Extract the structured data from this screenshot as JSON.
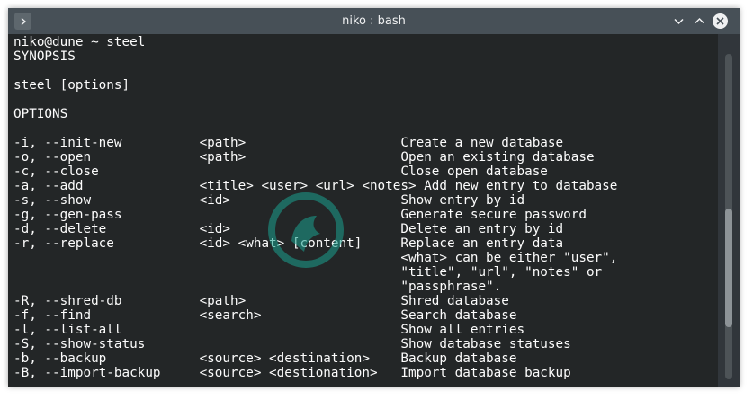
{
  "window": {
    "title": "niko : bash"
  },
  "terminal": {
    "lines": [
      "niko@dune ~ steel",
      "SYNOPSIS",
      "",
      "steel [options]",
      "",
      "OPTIONS",
      "",
      "-i, --init-new          <path>                    Create a new database",
      "-o, --open              <path>                    Open an existing database",
      "-c, --close                                       Close open database",
      "-a, --add               <title> <user> <url> <notes> Add new entry to database",
      "-s, --show              <id>                      Show entry by id",
      "-g, --gen-pass                                    Generate secure password",
      "-d, --delete            <id>                      Delete an entry by id",
      "-r, --replace           <id> <what> [content]     Replace an entry data",
      "                                                  <what> can be either \"user\",",
      "                                                  \"title\", \"url\", \"notes\" or",
      "                                                  \"passphrase\".",
      "-R, --shred-db          <path>                    Shred database",
      "-f, --find              <search>                  Search database",
      "-l, --list-all                                    Show all entries",
      "-S, --show-status                                 Show database statuses",
      "-b, --backup            <source> <destination>    Backup database",
      "-B, --import-backup     <source> <destionation>   Import database backup"
    ]
  },
  "icons": {
    "menu": "chevron-right-icon",
    "minimize": "chevron-down-icon",
    "maximize": "chevron-up-icon",
    "close": "close-icon"
  },
  "colors": {
    "titlebar": "#475057",
    "terminal_bg": "#232627",
    "terminal_fg": "#fcfcfc",
    "watermark": "#1aa18f"
  }
}
